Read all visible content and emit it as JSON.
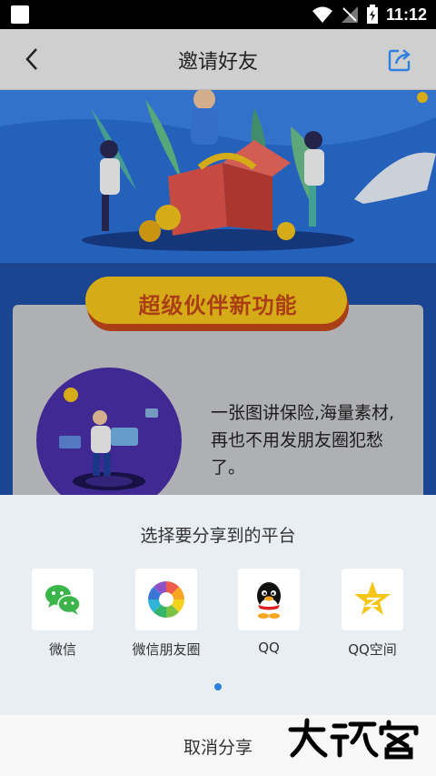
{
  "status": {
    "time": "11:12"
  },
  "navbar": {
    "title": "邀请好友"
  },
  "banner": {
    "badge": "超级伙伴新功能",
    "description": "一张图讲保险,海量素材,再也不用发朋友圈犯愁了。"
  },
  "share_sheet": {
    "title": "选择要分享到的平台",
    "platforms": [
      {
        "label": "微信",
        "icon": "wechat-icon"
      },
      {
        "label": "微信朋友圈",
        "icon": "moments-icon"
      },
      {
        "label": "QQ",
        "icon": "qq-icon"
      },
      {
        "label": "QQ空间",
        "icon": "qzone-icon"
      }
    ]
  },
  "cancel": {
    "label": "取消分享"
  },
  "watermark": {
    "text": "大玩客"
  },
  "colors": {
    "accent": "#2d7fe0",
    "banner_bg": "#1f4fa5",
    "badge": "#f3c41b"
  }
}
